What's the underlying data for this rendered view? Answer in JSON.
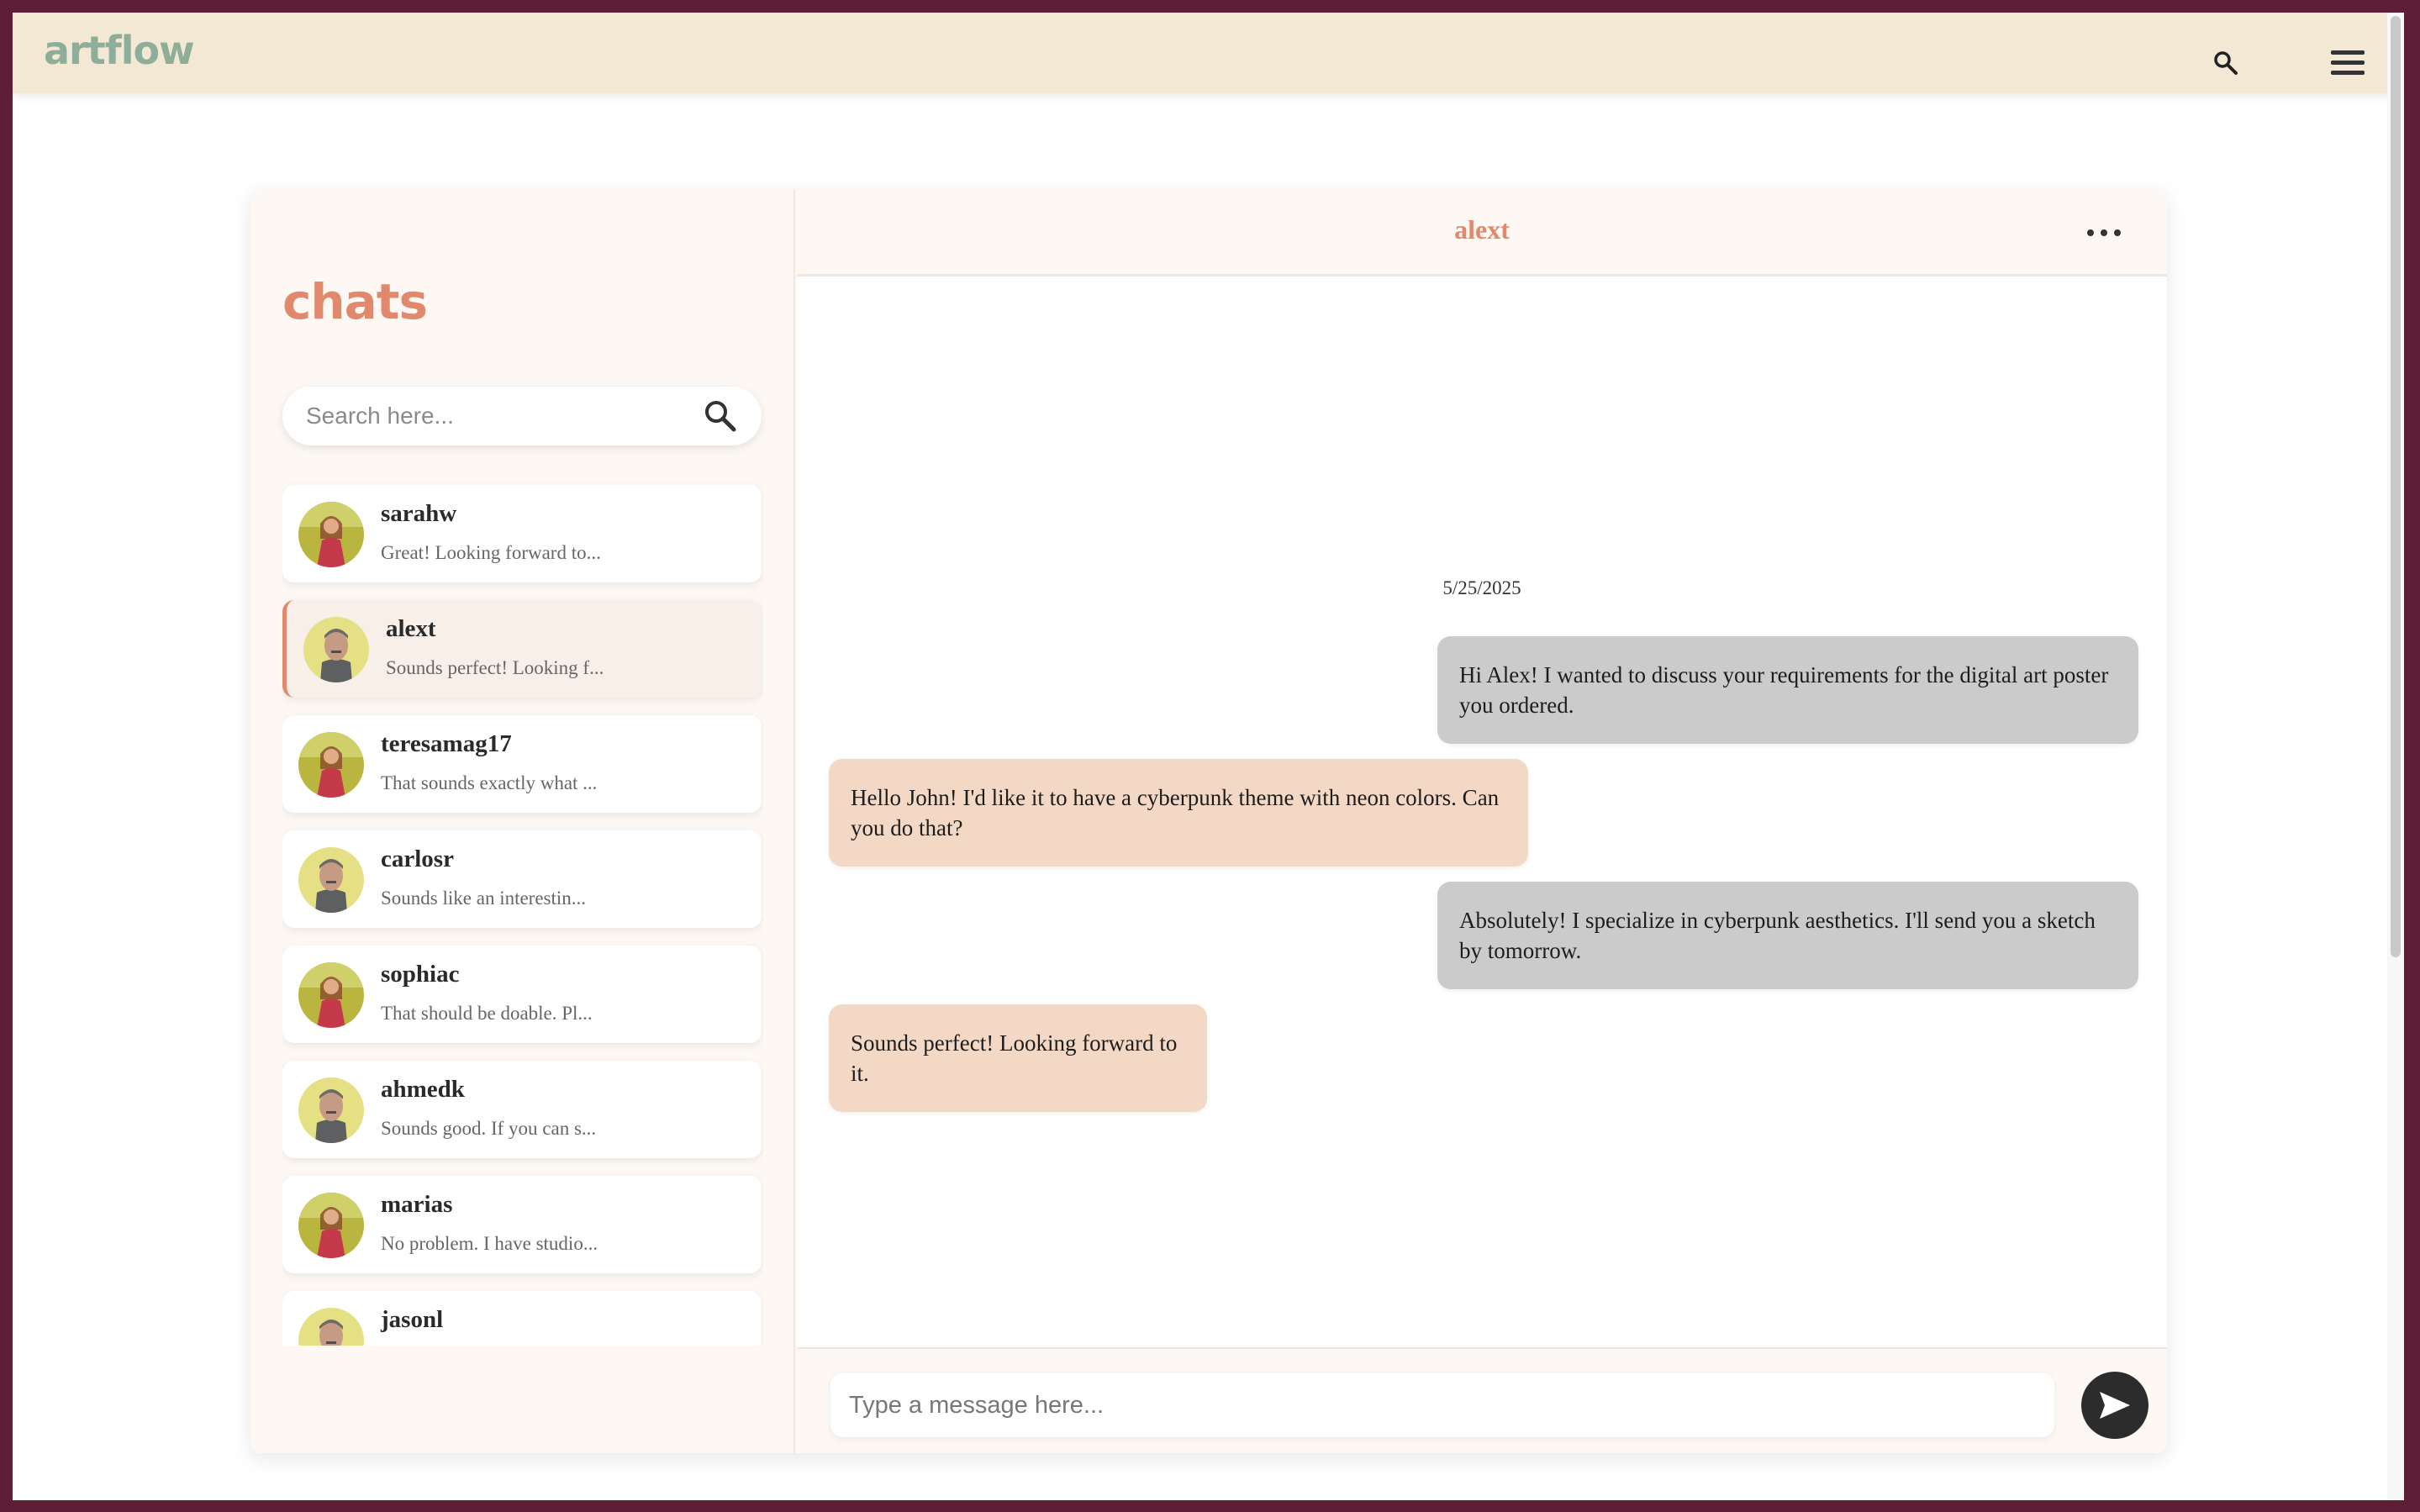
{
  "app": {
    "logo": "artflow"
  },
  "topbar": {
    "search_icon": "search-icon",
    "menu_icon": "hamburger-menu-icon"
  },
  "sidebar": {
    "title": "chats",
    "search": {
      "placeholder": "Search here...",
      "value": ""
    },
    "chats": [
      {
        "name": "sarahw",
        "preview": "Great! Looking forward to...",
        "avatar": "woman-avatar",
        "active": false
      },
      {
        "name": "alext",
        "preview": "Sounds perfect! Looking f...",
        "avatar": "man-avatar",
        "active": true
      },
      {
        "name": "teresamag17",
        "preview": "That sounds exactly what ...",
        "avatar": "woman-avatar",
        "active": false
      },
      {
        "name": "carlosr",
        "preview": "Sounds like an interestin...",
        "avatar": "man-avatar",
        "active": false
      },
      {
        "name": "sophiac",
        "preview": "That should be doable. Pl...",
        "avatar": "woman-avatar",
        "active": false
      },
      {
        "name": "ahmedk",
        "preview": "Sounds good. If you can s...",
        "avatar": "man-avatar",
        "active": false
      },
      {
        "name": "marias",
        "preview": "No problem. I have studio...",
        "avatar": "woman-avatar",
        "active": false
      },
      {
        "name": "jasonl",
        "preview": "",
        "avatar": "man-avatar",
        "active": false
      }
    ]
  },
  "conversation": {
    "title": "alext",
    "date": "5/25/2025",
    "messages": [
      {
        "from": "me",
        "text": "Hi Alex! I wanted to discuss your requirements for the digital art poster you ordered."
      },
      {
        "from": "alext",
        "text": "Hello John! I'd like it to have a cyberpunk theme with neon colors. Can you do that?"
      },
      {
        "from": "me",
        "text": "Absolutely! I specialize in cyberpunk aesthetics. I'll send you a sketch by tomorrow."
      },
      {
        "from": "alext",
        "text": "Sounds perfect! Looking forward to it."
      }
    ],
    "composer": {
      "placeholder": "Type a message here...",
      "value": ""
    }
  },
  "colors": {
    "accent": "#e0896c",
    "logo": "#8fae9a",
    "topbar": "#f2e8d3",
    "sent_bubble": "#cbcbcb",
    "received_bubble": "#f3d8c6",
    "frame": "#5e1e36"
  }
}
